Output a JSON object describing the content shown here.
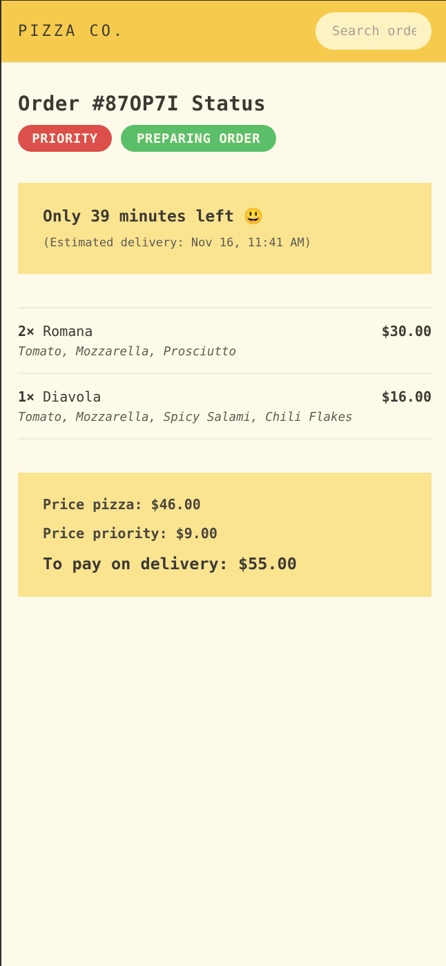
{
  "header": {
    "logo": "PIZZA CO.",
    "search_placeholder": "Search order #"
  },
  "order": {
    "title": "Order #87OP7I Status",
    "badges": {
      "priority": "PRIORITY",
      "status": "PREPARING ORDER"
    },
    "eta": {
      "main": "Only 39 minutes left 😃",
      "sub": "(Estimated delivery: Nov 16, 11:41 AM)"
    },
    "items": [
      {
        "quantity": "2×",
        "name": "Romana",
        "price": "$30.00",
        "ingredients": "Tomato, Mozzarella, Prosciutto"
      },
      {
        "quantity": "1×",
        "name": "Diavola",
        "price": "$16.00",
        "ingredients": "Tomato, Mozzarella, Spicy Salami, Chili Flakes"
      }
    ],
    "summary": {
      "price_pizza": "Price pizza: $46.00",
      "price_priority": "Price priority: $9.00",
      "to_pay": "To pay on delivery: $55.00"
    }
  },
  "colors": {
    "header_bg": "#f6cb4d",
    "page_bg": "#fefae9",
    "panel_bg": "#fae490",
    "priority_badge": "#dc4f4a",
    "status_badge": "#5bbf6a"
  }
}
